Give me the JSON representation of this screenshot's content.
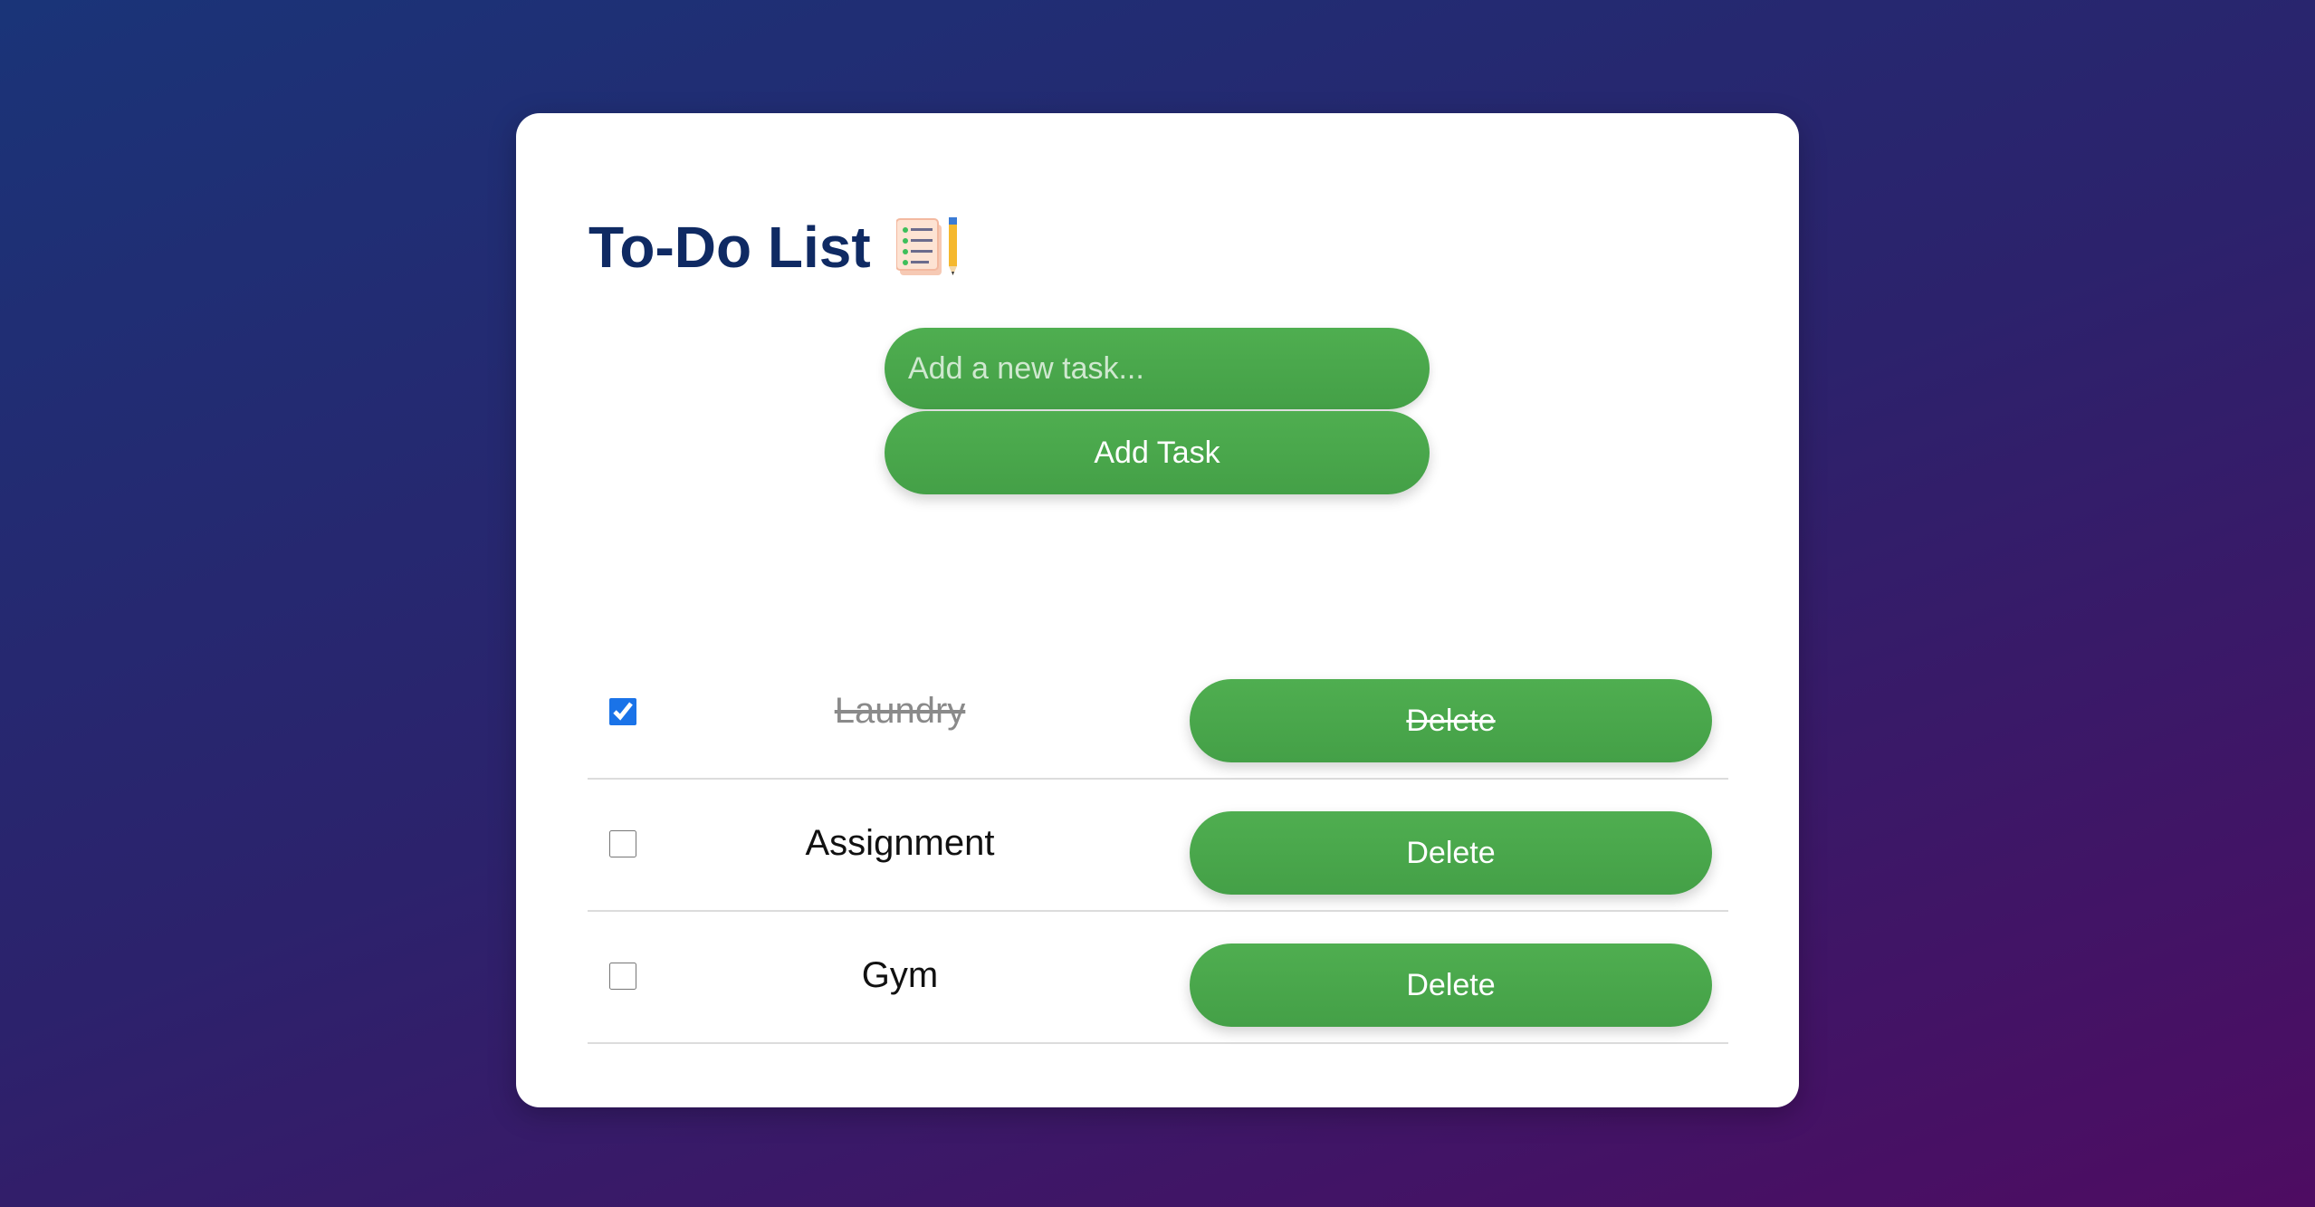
{
  "app": {
    "title": "To-Do List",
    "title_icon": "clipboard-pencil-icon"
  },
  "form": {
    "input_value": "",
    "input_placeholder": "Add a new task...",
    "add_button_label": "Add Task"
  },
  "tasks": [
    {
      "text": "Laundry",
      "done": true,
      "delete_label": "Delete"
    },
    {
      "text": "Assignment",
      "done": false,
      "delete_label": "Delete"
    },
    {
      "text": "Gym",
      "done": false,
      "delete_label": "Delete"
    }
  ],
  "colors": {
    "accent_green": "#4caf50",
    "title_navy": "#0f2a63",
    "checkbox_blue": "#1a73e8"
  }
}
